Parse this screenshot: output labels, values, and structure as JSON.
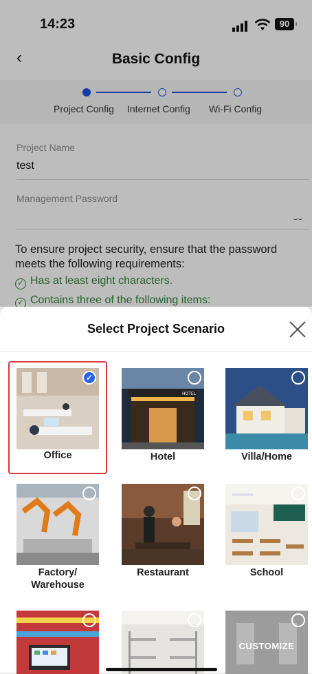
{
  "status": {
    "time": "14:23",
    "battery": "90"
  },
  "nav": {
    "title": "Basic Config",
    "back_icon": "chevron-left-icon"
  },
  "steps": [
    {
      "label": "Project Config",
      "active": true
    },
    {
      "label": "Internet Config",
      "active": false
    },
    {
      "label": "Wi-Fi Config",
      "active": false
    }
  ],
  "form": {
    "project_name_label": "Project Name",
    "project_name_value": "test",
    "password_label": "Management Password",
    "password_value": ""
  },
  "notice": {
    "text": "To ensure project security, ensure that the password meets the following requirements:",
    "req1": "Has at least eight characters.",
    "req2": "Contains three of the following items:"
  },
  "sheet": {
    "title": "Select Project Scenario",
    "close_icon": "close-icon",
    "scenarios": [
      {
        "label": "Office",
        "selected": true
      },
      {
        "label": "Hotel",
        "selected": false
      },
      {
        "label": "Villa/Home",
        "selected": false
      },
      {
        "label": "Factory/\nWarehouse",
        "selected": false
      },
      {
        "label": "Restaurant",
        "selected": false
      },
      {
        "label": "School",
        "selected": false
      },
      {
        "label": "",
        "selected": false
      },
      {
        "label": "",
        "selected": false
      },
      {
        "label": "CUSTOMIZE",
        "selected": false
      }
    ]
  },
  "colors": {
    "accent": "#1d4ed8",
    "success": "#2e7d32",
    "selected_border": "#d9363e"
  }
}
